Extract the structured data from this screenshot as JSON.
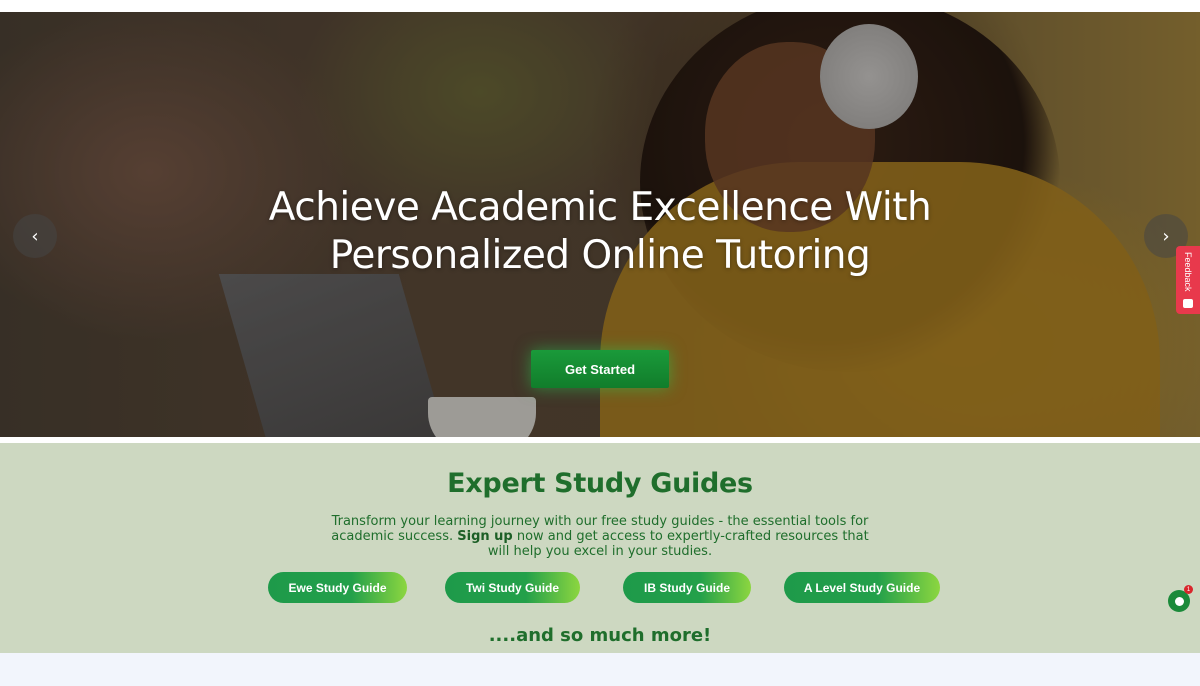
{
  "hero": {
    "title_line1": "Achieve Academic Excellence With",
    "title_line2": "Personalized Online Tutoring",
    "cta_label": "Get Started",
    "prev_arrow": "‹",
    "next_arrow": "›"
  },
  "feedback": {
    "label": "Feedback"
  },
  "guides": {
    "title": "Expert Study Guides",
    "text_before": "Transform your learning journey with our free study guides - the essential tools for academic success. ",
    "signup_label": "Sign up",
    "text_after": " now and get access to expertly-crafted resources that will help you excel in your studies.",
    "buttons": [
      {
        "label": "Ewe Study Guide"
      },
      {
        "label": "Twi Study Guide"
      },
      {
        "label": "IB Study Guide"
      },
      {
        "label": "A Level Study Guide"
      }
    ],
    "more": "....and so much more!"
  },
  "chat": {
    "badge": "1"
  },
  "colors": {
    "brand_green": "#1f6e2c",
    "guides_bg": "#cdd8c1",
    "feedback_red": "#e8394c"
  }
}
